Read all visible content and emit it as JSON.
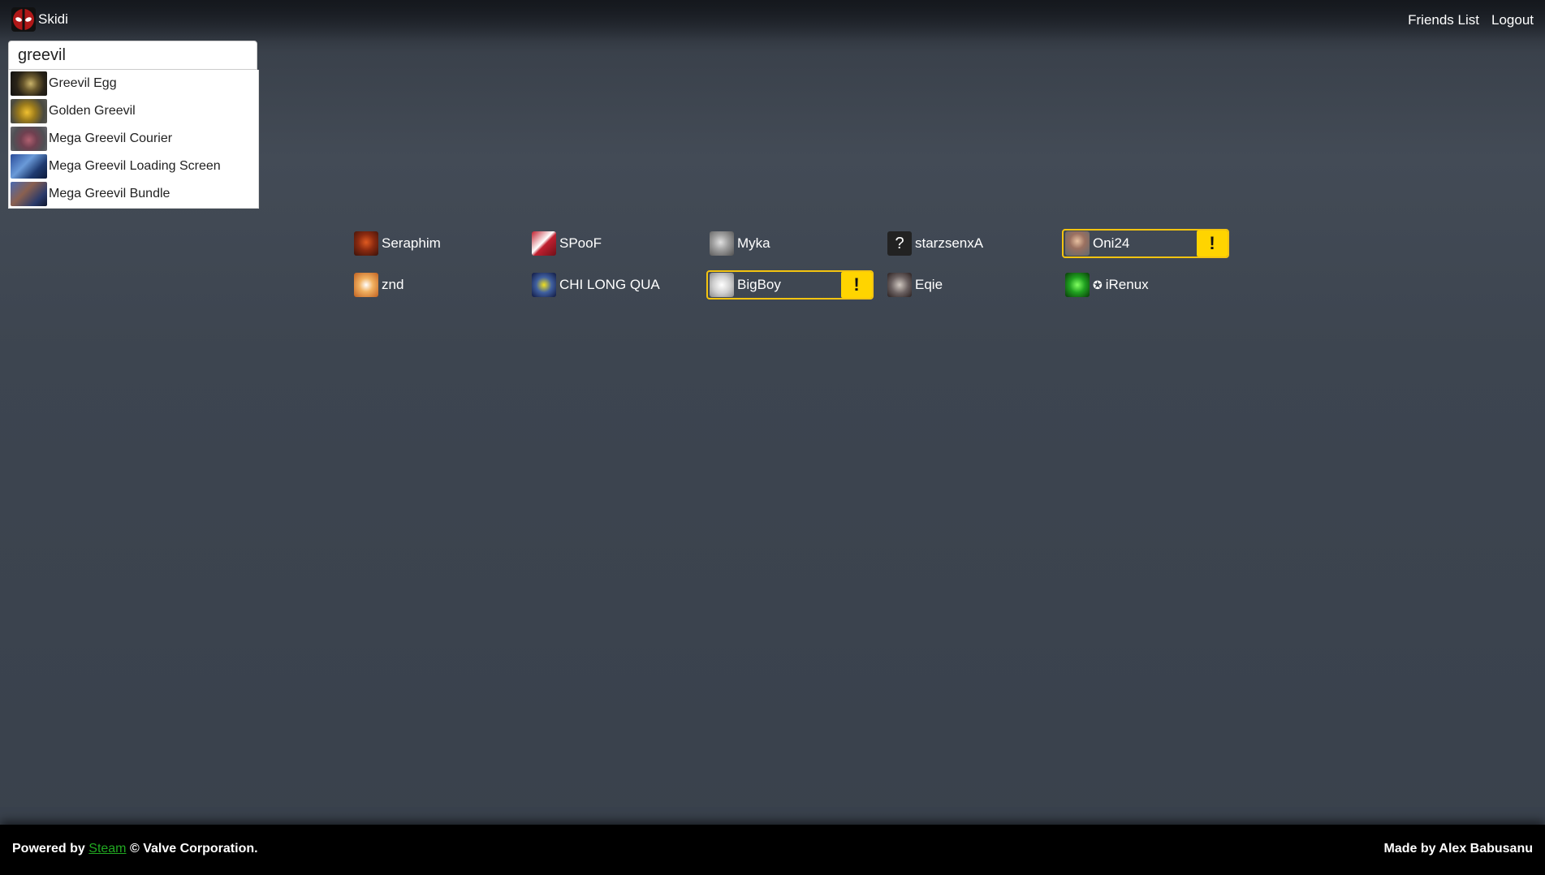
{
  "nav": {
    "brand": "Skidi",
    "links": [
      "Friends List",
      "Logout"
    ]
  },
  "search": {
    "value": "greevil",
    "suggestions": [
      "Greevil Egg",
      "Golden Greevil",
      "Mega Greevil Courier",
      "Mega Greevil Loading Screen",
      "Mega Greevil Bundle"
    ]
  },
  "friends": [
    {
      "name": "Seraphim",
      "alert": false
    },
    {
      "name": "SPooF",
      "alert": false
    },
    {
      "name": "Myka",
      "alert": false
    },
    {
      "name": "starzsenxA",
      "alert": false,
      "avatar_glyph": "?"
    },
    {
      "name": "Oni24",
      "alert": true,
      "alert_glyph": "!"
    },
    {
      "name": "znd",
      "alert": false
    },
    {
      "name": "CHI LONG QUA",
      "alert": false
    },
    {
      "name": "BigBoy",
      "alert": true,
      "alert_glyph": "!"
    },
    {
      "name": "Eqie",
      "alert": false
    },
    {
      "name": "iRenux",
      "alert": false,
      "prefix_glyph": "✪"
    }
  ],
  "footer": {
    "powered_prefix": "Powered by",
    "steam_link": "Steam",
    "copyright": "© Valve Corporation.",
    "credit": "Made by Alex Babusanu"
  },
  "colors": {
    "alert": "#ffd400",
    "alert_border": "#f4c410",
    "steam_link": "#21a821",
    "footer_bg": "#000000"
  }
}
